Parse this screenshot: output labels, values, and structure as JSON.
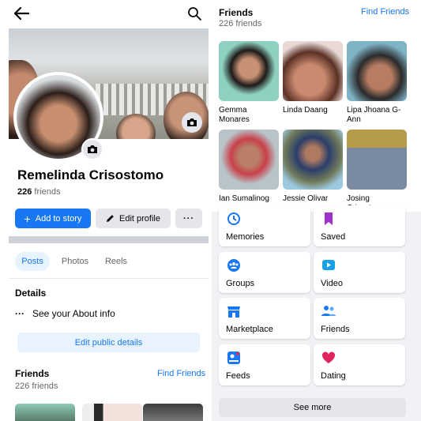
{
  "profile": {
    "name": "Remelinda Crisostomo",
    "friends_count": "226",
    "friends_word": "friends",
    "add_story": "Add to story",
    "edit_profile": "Edit profile",
    "more": "···"
  },
  "tabs": [
    "Posts",
    "Photos",
    "Reels"
  ],
  "details": {
    "heading": "Details",
    "about_dots": "···",
    "about_text": "See your About info",
    "edit_public": "Edit public details"
  },
  "friends_section": {
    "heading": "Friends",
    "count": "226 friends",
    "find": "Find Friends",
    "people": [
      {
        "name": "Gemma Monares"
      },
      {
        "name": "Linda Daang"
      },
      {
        "name": "Lipa Jhoana G-Ann"
      },
      {
        "name": "Ian Sumalinog"
      },
      {
        "name": "Jessie Olivar"
      },
      {
        "name": "Josing Crisostomo"
      }
    ]
  },
  "menu": [
    {
      "label": "Memories",
      "icon": "clock-icon",
      "color": "#1877f2"
    },
    {
      "label": "Saved",
      "icon": "bookmark-icon",
      "color": "#a033c9"
    },
    {
      "label": "Groups",
      "icon": "groups-icon",
      "color": "#1877f2"
    },
    {
      "label": "Video",
      "icon": "video-icon",
      "color": "#1aa0e6"
    },
    {
      "label": "Marketplace",
      "icon": "store-icon",
      "color": "#1877f2"
    },
    {
      "label": "Friends",
      "icon": "friends-icon",
      "color": "#1877f2"
    },
    {
      "label": "Feeds",
      "icon": "feeds-icon",
      "color": "#1877f2"
    },
    {
      "label": "Dating",
      "icon": "heart-icon",
      "color": "#e0245e"
    }
  ],
  "see_more": "See more",
  "colors": {
    "accent": "#1877f2",
    "button_gray": "#e4e6eb",
    "menu_bg": "#f0f2f5"
  }
}
